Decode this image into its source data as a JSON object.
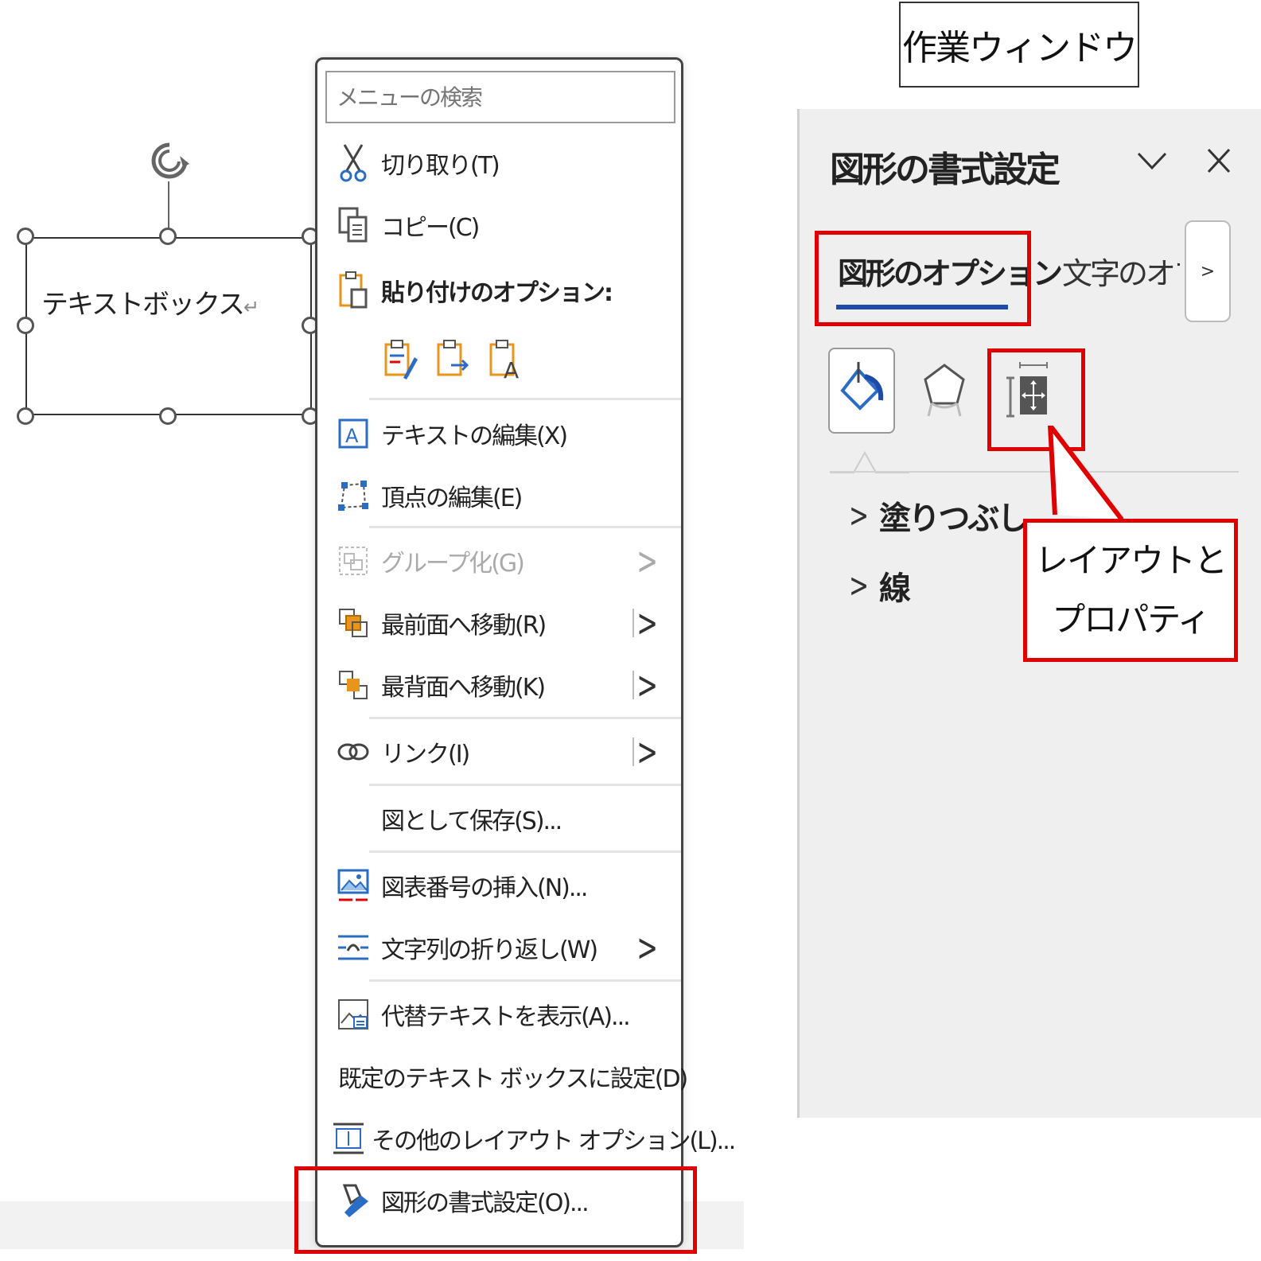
{
  "textbox": {
    "text": "テキストボックス",
    "return_mark": "↵"
  },
  "menu": {
    "search_placeholder": "メニューの検索",
    "items": [
      {
        "label": "切り取り(T)"
      },
      {
        "label": "コピー(C)"
      },
      {
        "label": "貼り付けのオプション:"
      },
      {
        "label": "テキストの編集(X)"
      },
      {
        "label": "頂点の編集(E)"
      },
      {
        "label": "グループ化(G)",
        "disabled": true
      },
      {
        "label": "最前面へ移動(R)"
      },
      {
        "label": "最背面へ移動(K)"
      },
      {
        "label": "リンク(I)"
      },
      {
        "label": "図として保存(S)..."
      },
      {
        "label": "図表番号の挿入(N)..."
      },
      {
        "label": "文字列の折り返し(W)"
      },
      {
        "label": "代替テキストを表示(A)..."
      },
      {
        "label": "既定のテキスト ボックスに設定(D)"
      },
      {
        "label": "その他のレイアウト オプション(L)..."
      },
      {
        "label": "図形の書式設定(O)..."
      }
    ]
  },
  "caption": "作業ウィンドウ",
  "pane": {
    "title": "図形の書式設定",
    "tabs": [
      "図形のオプション",
      "文字のオプション"
    ],
    "sections": [
      "塗りつぶし",
      "線"
    ]
  },
  "callout": {
    "line1": "レイアウトと",
    "line2": "プロパティ"
  },
  "colors": {
    "highlight": "#e00000",
    "tab_underline": "#1e4aa8",
    "icon_blue": "#2b6cc4",
    "icon_orange": "#e8951b"
  }
}
